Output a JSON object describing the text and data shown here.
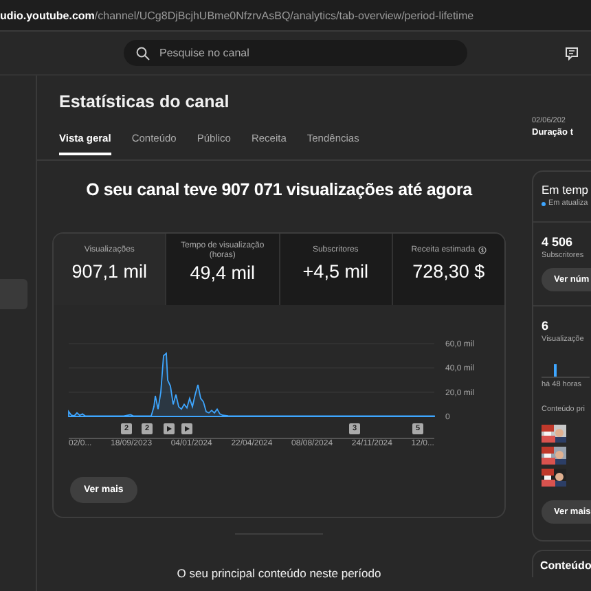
{
  "address_bar": {
    "host": "udio.youtube.com",
    "path": "/channel/UCg8DjBcjhUBme0NfzrvAsBQ/analytics/tab-overview/period-lifetime"
  },
  "search": {
    "placeholder": "Pesquise no canal"
  },
  "sidebar": {
    "items": [
      {
        "selected": true
      }
    ]
  },
  "header": {
    "title": "Estatísticas do canal",
    "tabs": [
      {
        "label": "Vista geral",
        "selected": true
      },
      {
        "label": "Conteúdo",
        "selected": false
      },
      {
        "label": "Público",
        "selected": false
      },
      {
        "label": "Receita",
        "selected": false
      },
      {
        "label": "Tendências",
        "selected": false
      }
    ],
    "date_range": {
      "dates": "02/06/202",
      "label": "Duração t"
    }
  },
  "overview": {
    "headline": "O seu canal teve 907 071 visualizações até agora",
    "metrics": [
      {
        "label": "Visualizações",
        "value": "907,1 mil",
        "selected": true,
        "info": false
      },
      {
        "label": "Tempo de visualização (horas)",
        "value": "49,4 mil",
        "selected": false,
        "info": false
      },
      {
        "label": "Subscritores",
        "value": "+4,5 mil",
        "selected": false,
        "info": false
      },
      {
        "label": "Receita estimada",
        "value": "728,30 $",
        "selected": false,
        "info": true
      }
    ],
    "chart": {
      "y_ticks": [
        "60,0 mil",
        "40,0 mil",
        "20,0 mil",
        "0"
      ],
      "x_labels": [
        "02/0...",
        "18/09/2023",
        "04/01/2024",
        "22/04/2024",
        "08/08/2024",
        "24/11/2024",
        "12/0..."
      ],
      "markers": [
        {
          "kind": "number",
          "label": "2"
        },
        {
          "kind": "number",
          "label": "2"
        },
        {
          "kind": "video"
        },
        {
          "kind": "video"
        },
        {
          "kind": "number",
          "label": "3"
        },
        {
          "kind": "number",
          "label": "5"
        }
      ]
    },
    "button": "Ver mais"
  },
  "top_content_heading": "O seu principal conteúdo neste período",
  "realtime": {
    "title": "Em temp",
    "status": "Em atualiza",
    "subscribers": "4 506",
    "subscribers_label": "Subscritores",
    "subscribers_button": "Ver núm",
    "views": "6",
    "views_label": "Visualizaçõe",
    "time_label": "há 48 horas",
    "content_label": "Conteúdo pri",
    "button": "Ver mais"
  },
  "next_card": {
    "title": "Conteúdo"
  }
}
